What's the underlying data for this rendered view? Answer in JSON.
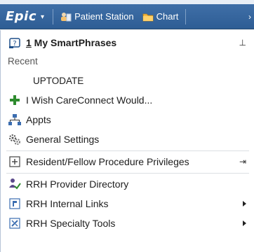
{
  "toolbar": {
    "epic_label": "Epic",
    "epic_caret": "▾",
    "patient_station": "Patient Station",
    "chart": "Chart"
  },
  "menu": {
    "header": {
      "accel": "1",
      "text": " My SmartPhrases",
      "pin": "⊥"
    },
    "recent_label": "Recent",
    "items": [
      {
        "label": "UPTODATE"
      },
      {
        "label": "I Wish CareConnect Would..."
      },
      {
        "label": "Appts"
      },
      {
        "label": "General Settings"
      },
      {
        "label": "Resident/Fellow Procedure Privileges",
        "right": "⇥"
      },
      {
        "label": "RRH Provider Directory"
      },
      {
        "label": "RRH Internal Links"
      },
      {
        "label": "RRH Specialty Tools"
      }
    ]
  },
  "colors": {
    "toolbar_bg": "#3a6aa3",
    "plus_green": "#2e8b2e",
    "accent_blue": "#2e5d94"
  }
}
